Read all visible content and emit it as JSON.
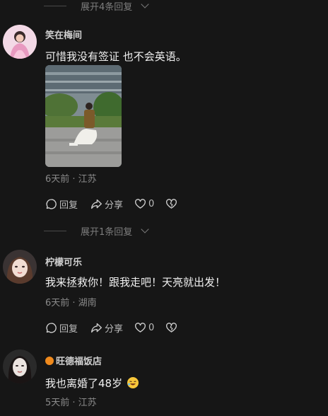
{
  "thread": {
    "expand_top": "展开4条回复",
    "expand_mid": "展开1条回复"
  },
  "comments": [
    {
      "username": "笑在梅间",
      "text": "可惜我没有签证 也不会英语。",
      "meta": "6天前 · 江苏",
      "actions": {
        "reply": "回复",
        "share": "分享",
        "likes": "0"
      }
    },
    {
      "username": "柠檬可乐",
      "text": "我来拯救你！跟我走吧！天亮就出发！",
      "meta": "6天前 · 湖南",
      "actions": {
        "reply": "回复",
        "share": "分享",
        "likes": "0"
      }
    },
    {
      "username": "旺德福饭店",
      "text": "我也离婚了48岁",
      "meta": "5天前 · 江苏",
      "badge_color": "#f08a1d",
      "emoji": "rolling-laughing-emoji"
    }
  ],
  "colors": {
    "background": "#161616",
    "text": "#f0f0f0",
    "muted": "#8a8a8a"
  }
}
